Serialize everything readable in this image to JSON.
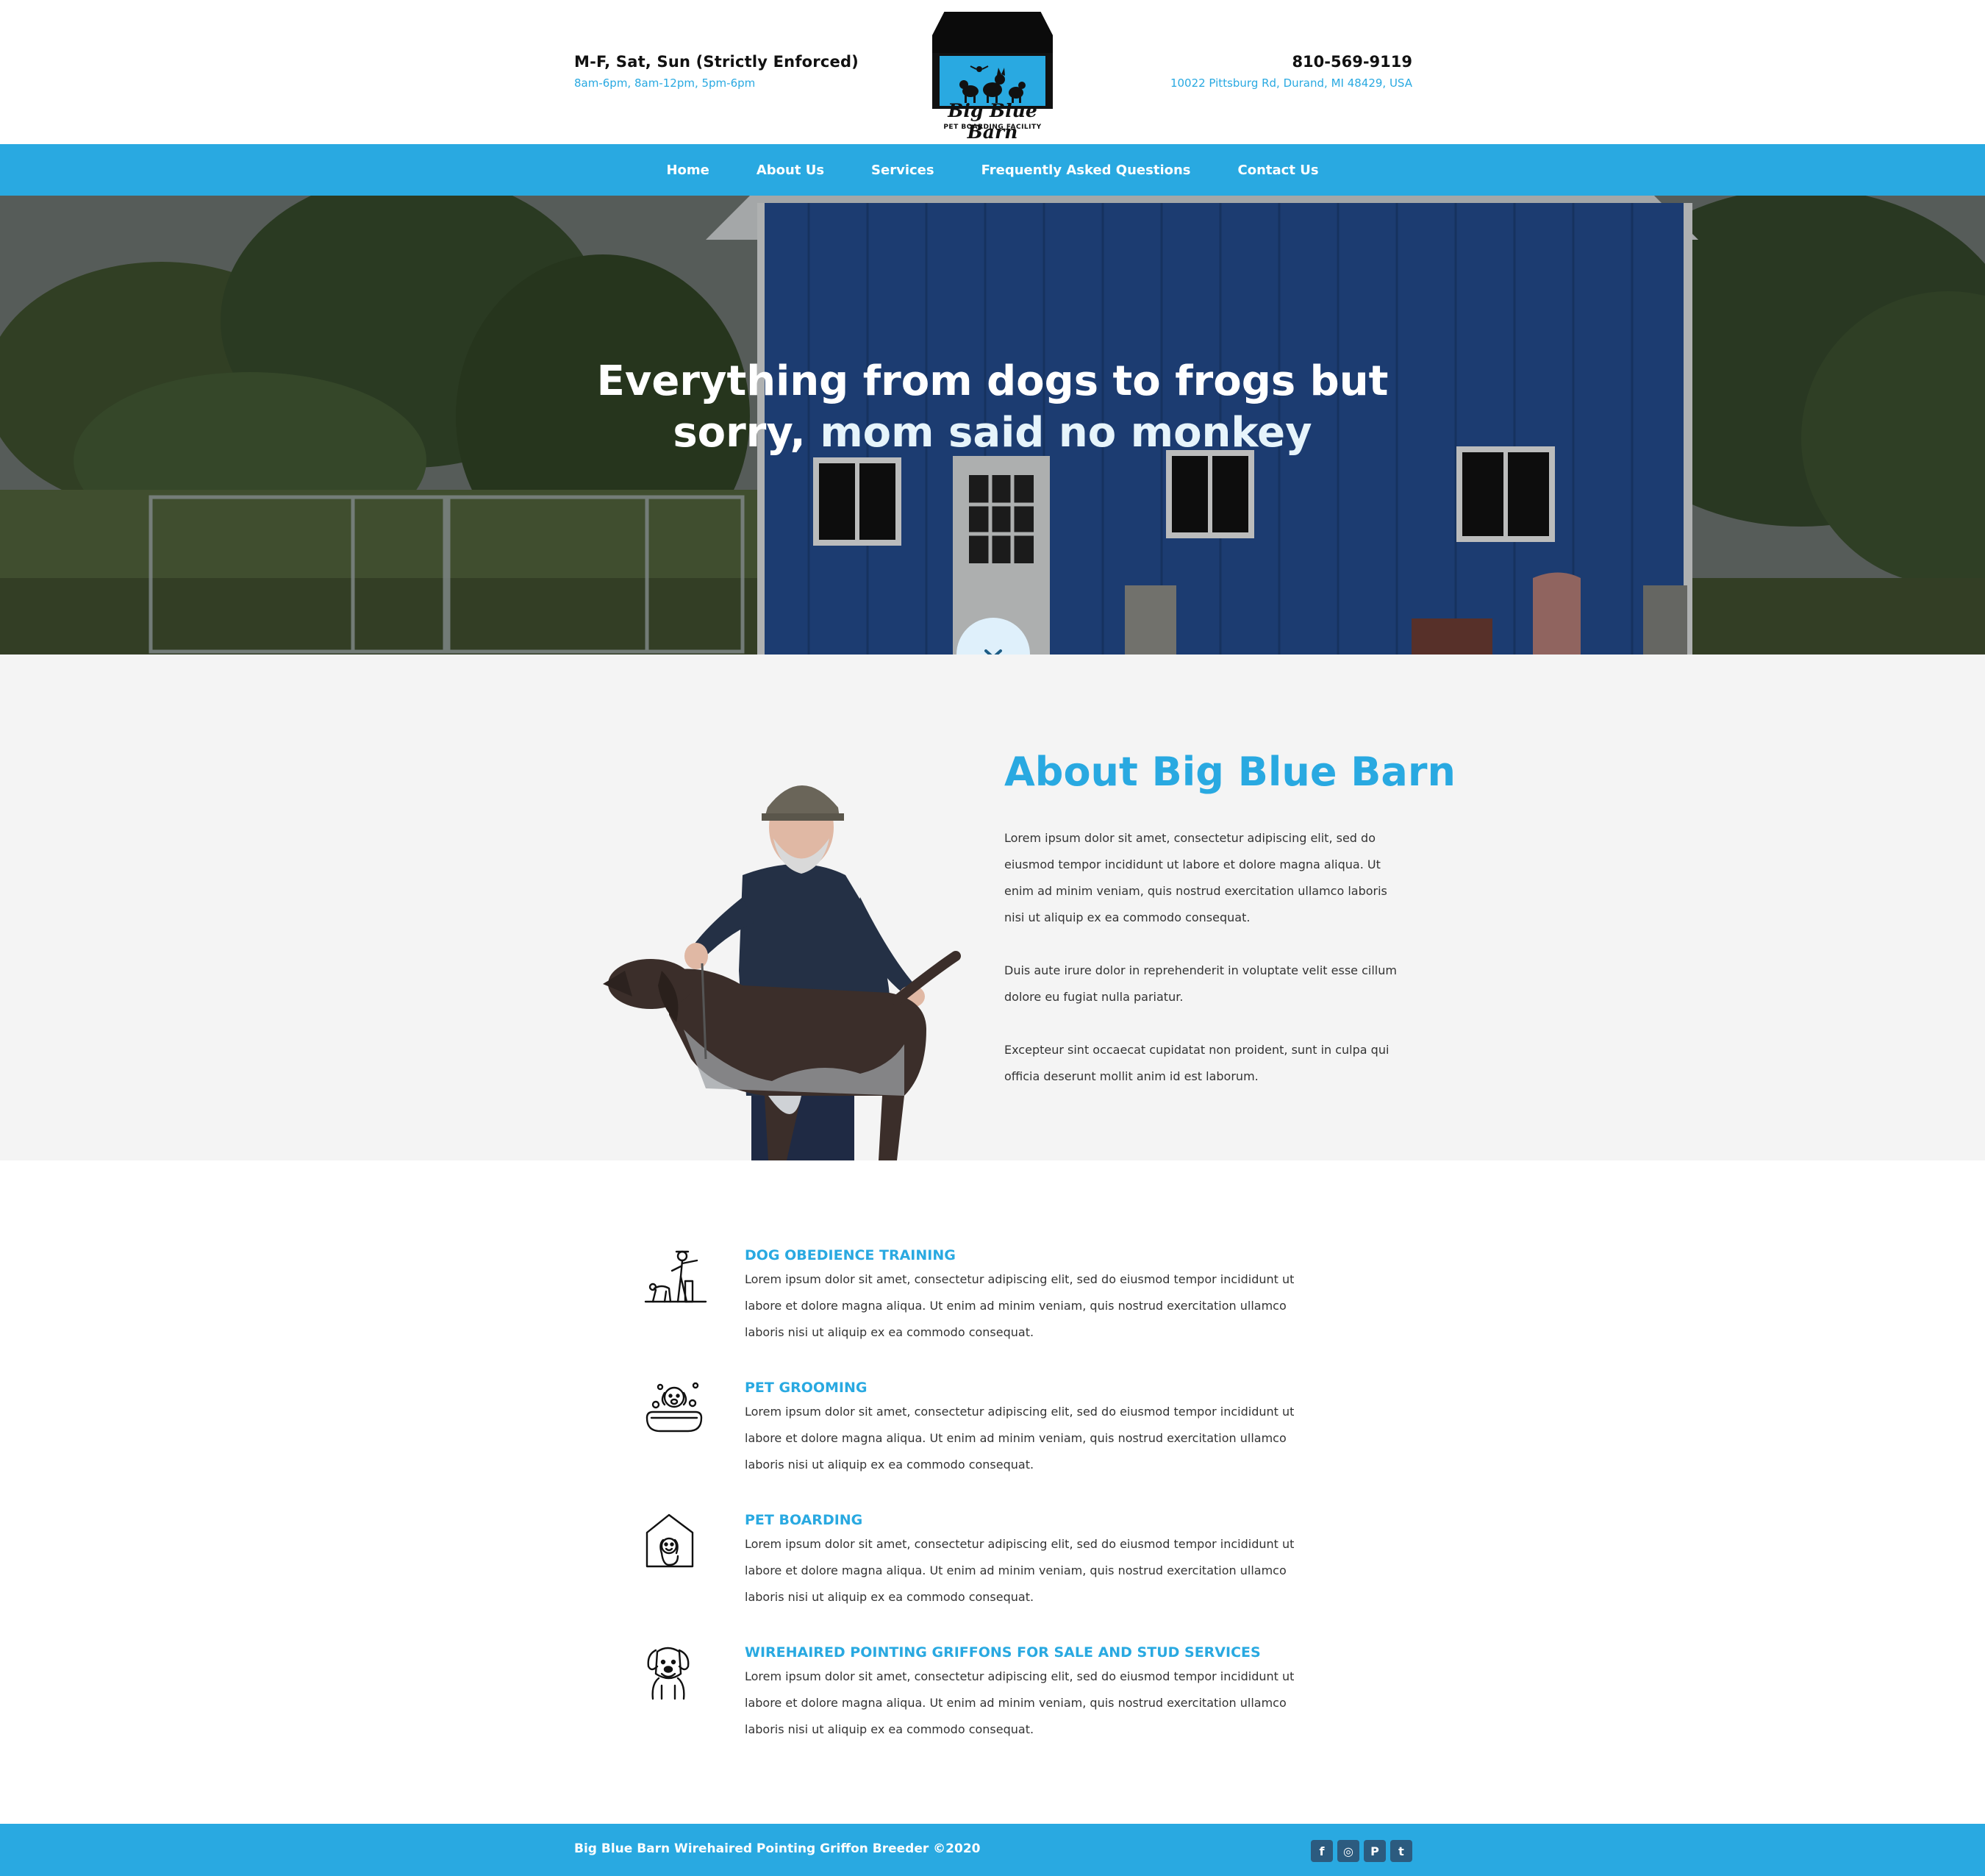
{
  "header": {
    "hours_title": "M-F, Sat, Sun (Strictly Enforced)",
    "hours_detail": "8am-6pm, 8am-12pm, 5pm-6pm",
    "phone": "810-569-9119",
    "address": "10022 Pittsburg Rd, Durand, MI 48429, USA",
    "logo_name": "Big Blue Barn",
    "logo_sub": "PET BOARDING FACILITY"
  },
  "nav": {
    "items": [
      {
        "label": "Home"
      },
      {
        "label": "About Us"
      },
      {
        "label": "Services"
      },
      {
        "label": "Frequently Asked Questions"
      },
      {
        "label": "Contact Us"
      }
    ]
  },
  "hero": {
    "line1": "Everything from dogs to frogs but",
    "line2_a": "sorry, ",
    "line2_b": "mom said no monkey",
    "scroll_icon": "chevron-down-icon"
  },
  "about": {
    "title": "About Big Blue Barn",
    "paragraphs": [
      "Lorem ipsum dolor sit amet, consectetur adipiscing elit, sed do eiusmod tempor incididunt ut labore et dolore magna aliqua. Ut enim ad minim veniam, quis nostrud exercitation ullamco laboris nisi ut aliquip ex ea commodo consequat.",
      "Duis aute irure dolor in reprehenderit in voluptate velit esse cillum dolore eu fugiat nulla pariatur.",
      "Excepteur sint occaecat cupidatat non proident, sunt in culpa qui officia deserunt mollit anim id est laborum."
    ]
  },
  "services": [
    {
      "title": "DOG OBEDIENCE TRAINING",
      "icon": "dog-training-icon",
      "desc": "Lorem ipsum dolor sit amet, consectetur adipiscing elit, sed do eiusmod tempor incididunt ut labore et dolore magna aliqua. Ut enim ad minim veniam, quis nostrud exercitation ullamco laboris nisi ut aliquip ex ea commodo consequat."
    },
    {
      "title": "PET GROOMING",
      "icon": "dog-bath-icon",
      "desc": "Lorem ipsum dolor sit amet, consectetur adipiscing elit, sed do eiusmod tempor incididunt ut labore et dolore magna aliqua. Ut enim ad minim veniam, quis nostrud exercitation ullamco laboris nisi ut aliquip ex ea commodo consequat."
    },
    {
      "title": "PET BOARDING",
      "icon": "dog-house-icon",
      "desc": "Lorem ipsum dolor sit amet, consectetur adipiscing elit, sed do eiusmod tempor incididunt ut labore et dolore magna aliqua. Ut enim ad minim veniam, quis nostrud exercitation ullamco laboris nisi ut aliquip ex ea commodo consequat."
    },
    {
      "title": "WIREHAIRED POINTING GRIFFONS FOR SALE AND STUD SERVICES",
      "icon": "griffon-dog-icon",
      "desc": "Lorem ipsum dolor sit amet, consectetur adipiscing elit, sed do eiusmod tempor incididunt ut labore et dolore magna aliqua. Ut enim ad minim veniam, quis nostrud exercitation ullamco laboris nisi ut aliquip ex ea commodo consequat."
    }
  ],
  "footer": {
    "copyright": "Big Blue Barn Wirehaired Pointing Griffon Breeder ©2020",
    "social": [
      {
        "icon": "facebook-icon",
        "glyph": "f"
      },
      {
        "icon": "instagram-icon",
        "glyph": "◎"
      },
      {
        "icon": "pinterest-icon",
        "glyph": "P"
      },
      {
        "icon": "twitter-icon",
        "glyph": "t"
      }
    ]
  },
  "colors": {
    "accent": "#29a9e1",
    "barn_blue": "#234a8a",
    "about_bg": "#f4f4f4",
    "social_bg": "#2c5b7f"
  }
}
